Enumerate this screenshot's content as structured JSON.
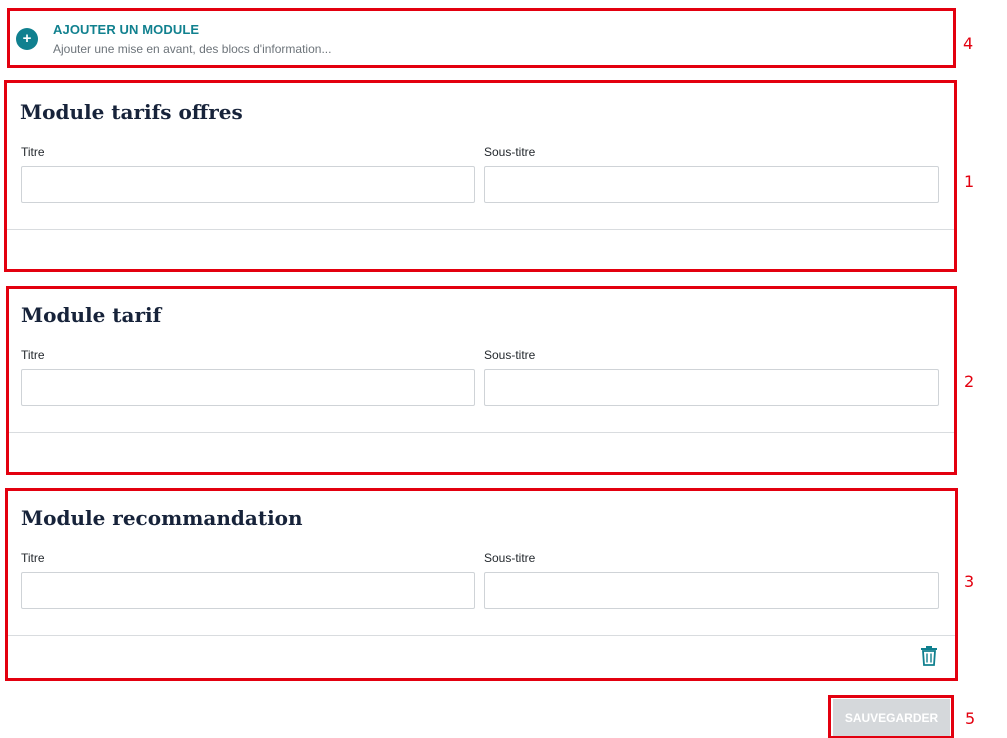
{
  "add_module": {
    "icon": "plus-circle-icon",
    "title": "AJOUTER UN MODULE",
    "subtitle": "Ajouter une mise en avant, des blocs d'information..."
  },
  "modules": [
    {
      "title": "Module tarifs offres",
      "title_label": "Titre",
      "subtitle_label": "Sous-titre",
      "title_value": "",
      "subtitle_value": ""
    },
    {
      "title": "Module tarif",
      "title_label": "Titre",
      "subtitle_label": "Sous-titre",
      "title_value": "",
      "subtitle_value": ""
    },
    {
      "title": "Module recommandation",
      "title_label": "Titre",
      "subtitle_label": "Sous-titre",
      "title_value": "",
      "subtitle_value": "",
      "delete_icon": "trash-icon"
    }
  ],
  "save_button": {
    "label": "SAUVEGARDER",
    "state": "disabled"
  },
  "annotations": [
    "4",
    "1",
    "2",
    "3",
    "5"
  ],
  "colors": {
    "accent": "#10808f",
    "annotation": "#e3000f",
    "title": "#17233a",
    "save_disabled": "#d5d8db"
  }
}
